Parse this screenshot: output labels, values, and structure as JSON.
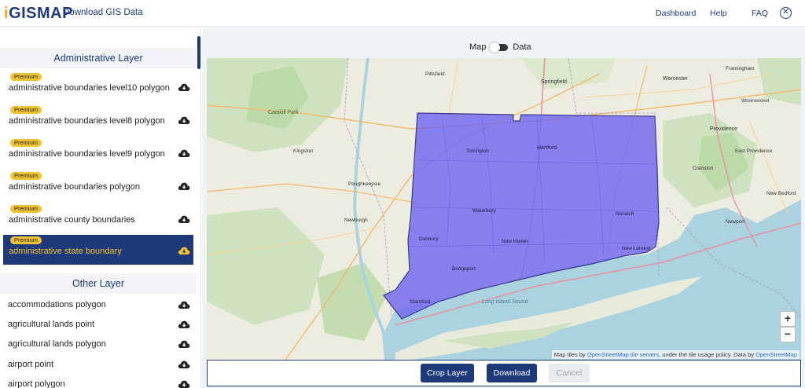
{
  "header": {
    "logo_prefix": "i",
    "logo_main": "GISMAP",
    "title": "Download GIS Data",
    "nav": [
      "Dashboard",
      "Help",
      "FAQ"
    ]
  },
  "sidebar": {
    "admin_heading": "Administrative Layer",
    "admin_items": [
      {
        "badge": "Premium",
        "label": "administrative boundaries level10 polygon"
      },
      {
        "badge": "Premium",
        "label": "administrative boundaries level8 polygon"
      },
      {
        "badge": "Premium",
        "label": "administrative boundaries level9 polygon"
      },
      {
        "badge": "Premium",
        "label": "administrative boundaries polygon"
      },
      {
        "badge": "Premium",
        "label": "administrative county boundaries"
      },
      {
        "badge": "Premium",
        "label": "administrative state boundary"
      }
    ],
    "other_heading": "Other Layer",
    "other_items": [
      {
        "label": "accommodations polygon"
      },
      {
        "label": "agricultural lands point"
      },
      {
        "label": "agricultural lands polygon"
      },
      {
        "label": "airport point"
      },
      {
        "label": "airport polygon"
      }
    ]
  },
  "toggle": {
    "left": "Map",
    "right": "Data"
  },
  "map": {
    "labels": {
      "catskill": "Catskill Park",
      "poughkeepsie": "Poughkeepsie",
      "newburgh": "Newburgh",
      "hartford": "Hartford",
      "springfield": "Springfield",
      "waterbury": "Waterbury",
      "new_haven": "New Haven",
      "bridgeport": "Bridgeport",
      "stamford": "Stamford",
      "new_london": "New London",
      "norwich": "Norwich",
      "providence": "Providence",
      "long_island_sound": "Long Island Sound",
      "cranston": "Cranston",
      "east_providence": "East Providence",
      "newport": "Newport",
      "framingham": "Framingham",
      "worcester": "Worcester",
      "woonsocket": "Woonsocket",
      "new_bedford": "New Bedford",
      "kingston": "Kingston",
      "danbury": "Danbury",
      "pittsfield": "Pittsfield",
      "torrington": "Torrington"
    },
    "zoom_in": "+",
    "zoom_out": "−",
    "attribution_prefix": "Map tiles by ",
    "attribution_link1": "OpenStreetMap tile servers",
    "attribution_mid": ", under the tile usage policy. Data by ",
    "attribution_link2": "OpenStreetMap"
  },
  "actions": {
    "crop": "Crop Layer",
    "download": "Download",
    "cancel": "Cancel"
  },
  "colors": {
    "brand": "#1f3a7a",
    "premium": "#f1c232",
    "selection": "#6c5cf5"
  }
}
